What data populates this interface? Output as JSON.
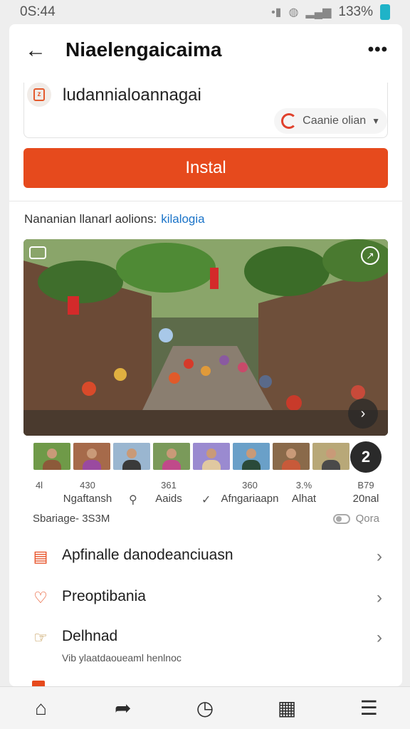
{
  "status_bar": {
    "time": "0S:44",
    "icons": [
      "bluetooth-icon",
      "wifi-icon",
      "signal-icon",
      "battery-icon"
    ],
    "battery_percent": "133%"
  },
  "header": {
    "title": "Niaelengaicaima",
    "back_icon": "back-arrow-icon",
    "more_icon": "more-icon"
  },
  "app": {
    "name": "ludannialoannagai",
    "developer": "Caanie olian",
    "install_label": "Instal",
    "accent_color": "#e64a1d"
  },
  "info": {
    "text": "Nananian llanarl aolions:",
    "link": "kilalogia"
  },
  "stats": [
    {
      "num": "4l",
      "label": ""
    },
    {
      "num": "430",
      "label": "Ngaftansh"
    },
    {
      "num": "361",
      "label": "Aaids"
    },
    {
      "num": "360",
      "label": "Afngariaapn"
    },
    {
      "num": "3.%",
      "label": "Alhat"
    },
    {
      "num": "B79",
      "label": "20nal"
    }
  ],
  "screenshot_count": "2",
  "sub_row": {
    "left": "Sbariage- 3S3M",
    "right": "Qora"
  },
  "menu": [
    {
      "label": "Apfinalle danodeanciuasn",
      "sub": "",
      "icon": "list-icon",
      "icon_color": "#e64a1d"
    },
    {
      "label": "Preoptibania",
      "sub": "",
      "icon": "heart-icon",
      "icon_color": "#e64a1d"
    },
    {
      "label": "Delhnad",
      "sub": "Vib ylaatdaoueaml henlnoc",
      "icon": "thumb-icon",
      "icon_color": "#b88a3a"
    }
  ],
  "bottom_nav": [
    "home-icon",
    "share-icon",
    "clock-icon",
    "book-icon",
    "menu-icon"
  ]
}
